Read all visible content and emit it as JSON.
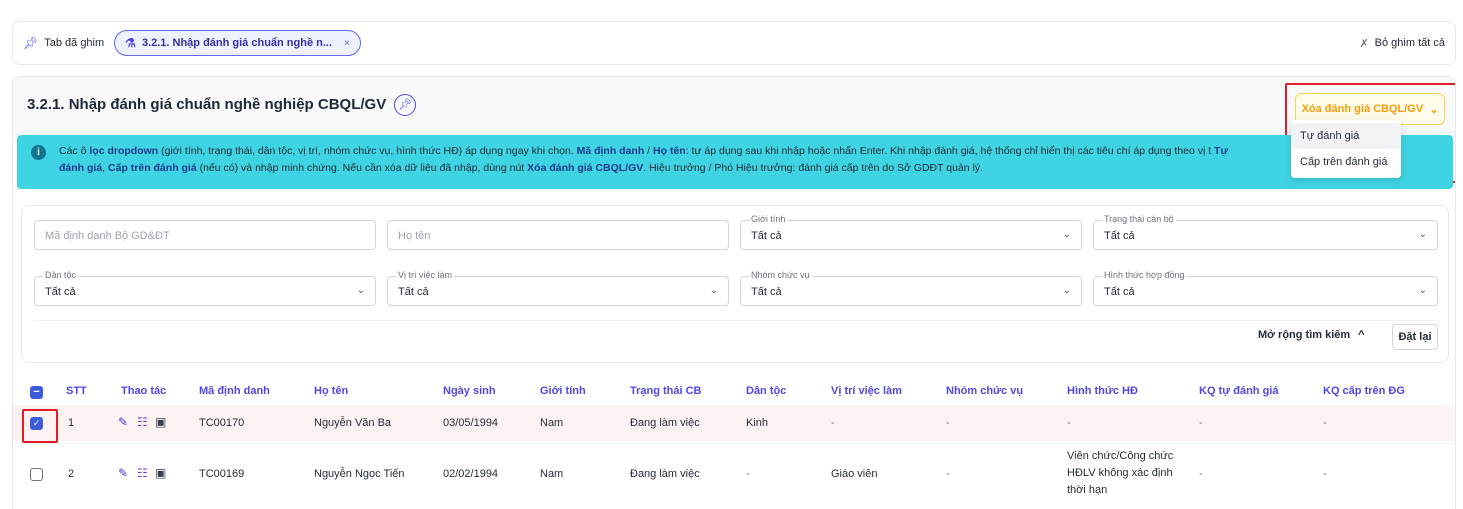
{
  "pinned": {
    "label": "Tab đã ghim",
    "chip_label": "3.2.1. Nhập đánh giá chuẩn nghề n...",
    "chip_close": "×",
    "unpin_all": "Bỏ ghim tất cả"
  },
  "page": {
    "title": "3.2.1. Nhập đánh giá chuẩn nghề nghiệp CBQL/GV",
    "delete_button": "Xóa đánh giá CBQL/GV",
    "menu": [
      "Tự đánh giá",
      "Cấp trên đánh giá"
    ]
  },
  "info": {
    "seg1": "Các ô ",
    "seg2": "lọc dropdown",
    "seg3": " (giới tính, trạng thái, dân tộc, vị trí, nhóm chức vụ, hình thức HĐ) áp dụng ngay khi chọn. ",
    "seg4": "Mã định danh",
    "seg5": " / ",
    "seg6": "Họ tên",
    "seg7": ": tự áp dụng sau khi nhập hoặc nhấn Enter. Khi nhập đánh giá, hệ thống chỉ hiển thị các tiêu chí áp dụng theo vị t",
    "seg8": "Tự",
    "seg9": "đánh giá",
    "seg10": ", ",
    "seg11": "Cấp trên đánh giá",
    "seg12": " (nếu có) và nhập minh chứng. Nếu cần xóa dữ liệu đã nhập, dùng nút ",
    "seg13": "Xóa đánh giá CBQL/GV",
    "seg14": ". Hiệu trưởng / Phó Hiệu trưởng: đánh giá cấp trên do Sở GDĐT quản lý."
  },
  "filters": {
    "id_placeholder": "Mã định danh Bộ GD&ĐT",
    "name_placeholder": "Họ tên",
    "gender": {
      "label": "Giới tính",
      "value": "Tất cả"
    },
    "staff_status": {
      "label": "Trạng thái cán bộ",
      "value": "Tất cả"
    },
    "ethnicity": {
      "label": "Dân tộc",
      "value": "Tất cả"
    },
    "position": {
      "label": "Vị trí việc làm",
      "value": "Tất cả"
    },
    "role_group": {
      "label": "Nhóm chức vụ",
      "value": "Tất cả"
    },
    "contract": {
      "label": "Hình thức hợp đồng",
      "value": "Tất cả"
    },
    "expand": "Mở rộng tìm kiếm",
    "expand_arrow": "^",
    "reset": "Đặt lại"
  },
  "table": {
    "headers": [
      "STT",
      "Thao tác",
      "Mã định danh",
      "Họ tên",
      "Ngày sinh",
      "Giới tính",
      "Trạng thái CB",
      "Dân tộc",
      "Vị trí việc làm",
      "Nhóm chức vụ",
      "Hình thức HĐ",
      "KQ tự đánh giá",
      "KQ cấp trên ĐG"
    ],
    "rows": [
      {
        "stt": "1",
        "id": "TC00170",
        "name": "Nguyễn Văn Ba",
        "dob": "03/05/1994",
        "gender": "Nam",
        "status": "Đang làm việc",
        "ethnicity": "Kinh",
        "position": "-",
        "role": "-",
        "contract": "-",
        "self": "-",
        "sup": "-",
        "checked": true
      },
      {
        "stt": "2",
        "id": "TC00169",
        "name": "Nguyễn Ngọc Tiến",
        "dob": "02/02/1994",
        "gender": "Nam",
        "status": "Đang làm việc",
        "ethnicity": "-",
        "position": "Giáo viên",
        "role": "-",
        "contract_l1": "Viên chức/Công chức",
        "contract_l2": "HĐLV không xác định",
        "contract_l3": "thời hạn",
        "self": "-",
        "sup": "-",
        "checked": false
      }
    ]
  },
  "icons": {
    "pin": "pin-icon",
    "unpin": "unpin-icon",
    "tree": "tree-icon",
    "edit": "pencil-icon",
    "review": "review-icon",
    "id_card": "id-card-icon",
    "info": "info-icon"
  },
  "colors": {
    "accent": "#4f46e5",
    "warning": "#f59e0b",
    "info_bg": "#3fd4e3",
    "highlight_border": "#e11d2a",
    "row_selected": "#fdf2f2"
  }
}
